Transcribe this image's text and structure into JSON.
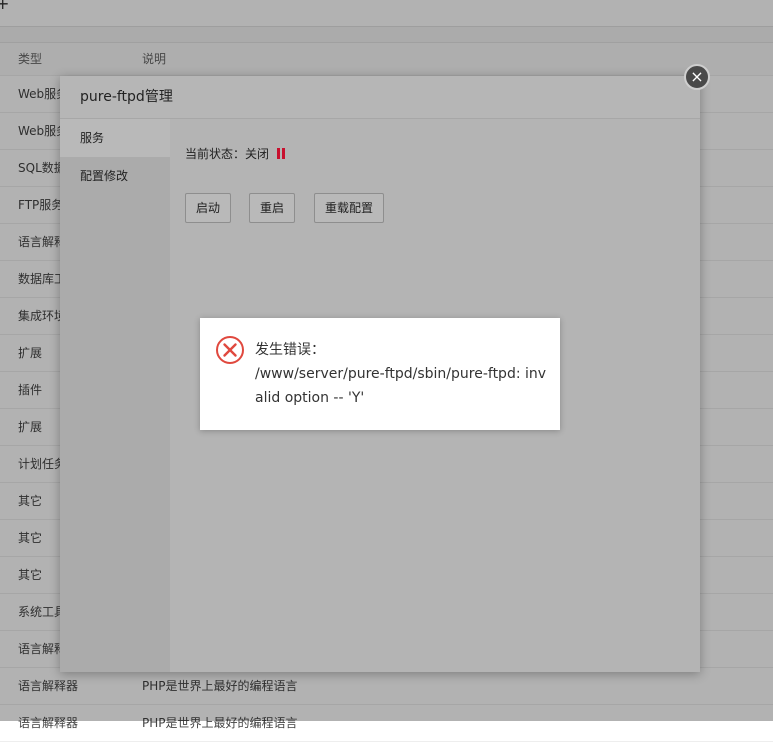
{
  "background": {
    "header": {
      "type": "类型",
      "desc": "说明"
    },
    "rows": [
      {
        "type": "Web服务",
        "desc": ""
      },
      {
        "type": "Web服务",
        "desc": ""
      },
      {
        "type": "SQL数据",
        "desc": ""
      },
      {
        "type": "FTP服务",
        "desc": ""
      },
      {
        "type": "语言解释",
        "desc": ""
      },
      {
        "type": "数据库工",
        "desc": ""
      },
      {
        "type": "集成环境",
        "desc": ""
      },
      {
        "type": "扩展",
        "desc": ""
      },
      {
        "type": "插件",
        "desc": ""
      },
      {
        "type": "扩展",
        "desc": ""
      },
      {
        "type": "计划任务",
        "desc": ""
      },
      {
        "type": "其它",
        "desc": ""
      },
      {
        "type": "其它",
        "desc": ""
      },
      {
        "type": "其它",
        "desc": ""
      },
      {
        "type": "系统工具",
        "desc": ""
      },
      {
        "type": "语言解释",
        "desc": ""
      },
      {
        "type": "语言解释器",
        "desc": "PHP是世界上最好的编程语言"
      },
      {
        "type": "语言解释器",
        "desc": "PHP是世界上最好的编程语言"
      }
    ]
  },
  "layer": {
    "title": "pure-ftpd管理",
    "close_symbol": "×",
    "sidebar": [
      {
        "label": "服务",
        "active": true
      },
      {
        "label": "配置修改",
        "active": false
      }
    ],
    "status_label": "当前状态：关闭",
    "status_color": "#c8102e",
    "buttons": {
      "start": "启动",
      "restart": "重启",
      "reload": "重载配置"
    }
  },
  "error": {
    "icon": "error-x-circle-icon",
    "icon_color": "#e0483e",
    "message_title": "发生错误：",
    "message_body": "/www/server/pure-ftpd/sbin/pure-ftpd: invalid option -- 'Y'"
  }
}
